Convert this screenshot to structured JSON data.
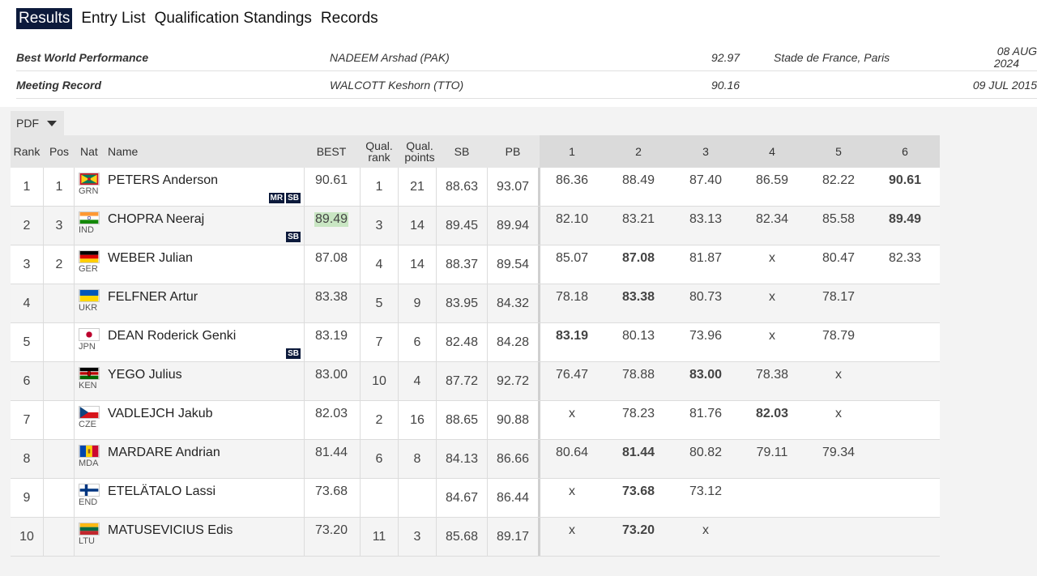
{
  "tabs": [
    "Results",
    "Entry List",
    "Qualification Standings",
    "Records"
  ],
  "records": [
    {
      "label": "Best World Performance",
      "name": "NADEEM Arshad (PAK)",
      "mark": "92.97",
      "venue": "Stade de France, Paris",
      "date_l1": "08 AUG",
      "date_l2": "2024"
    },
    {
      "label": "Meeting Record",
      "name": "WALCOTT Keshorn (TTO)",
      "mark": "90.16",
      "venue": "",
      "date_l1": "09 JUL 2015",
      "date_l2": ""
    }
  ],
  "pdf_label": "PDF",
  "headers": {
    "rank": "Rank",
    "pos": "Pos",
    "nat": "Nat",
    "name": "Name",
    "best": "BEST",
    "qrank_1": "Qual.",
    "qrank_2": "rank",
    "qpts_1": "Qual.",
    "qpts_2": "points",
    "sb": "SB",
    "pb": "PB",
    "a1": "1",
    "a2": "2",
    "a3": "3",
    "a4": "4",
    "a5": "5",
    "a6": "6"
  },
  "colors": {
    "accent": "#0c1a3b",
    "highlight": "#c9e6c3"
  },
  "rows": [
    {
      "rank": "1",
      "pos": "1",
      "nat": "GRN",
      "flag": "grenada-flag",
      "name": "PETERS Anderson",
      "badges": [
        "MR",
        "SB"
      ],
      "best": "90.61",
      "qrank": "1",
      "qpts": "21",
      "sb": "88.63",
      "pb": "93.07",
      "attempts": [
        "86.36",
        "88.49",
        "87.40",
        "86.59",
        "82.22",
        "90.61"
      ],
      "bold": [
        5
      ]
    },
    {
      "rank": "2",
      "pos": "3",
      "nat": "IND",
      "flag": "india-flag",
      "name": "CHOPRA Neeraj",
      "badges": [
        "SB"
      ],
      "best": "89.49",
      "qrank": "3",
      "qpts": "14",
      "sb": "89.45",
      "pb": "89.94",
      "attempts": [
        "82.10",
        "83.21",
        "83.13",
        "82.34",
        "85.58",
        "89.49"
      ],
      "bold": [
        5
      ]
    },
    {
      "rank": "3",
      "pos": "2",
      "nat": "GER",
      "flag": "germany-flag",
      "name": "WEBER Julian",
      "badges": [],
      "best": "87.08",
      "qrank": "4",
      "qpts": "14",
      "sb": "88.37",
      "pb": "89.54",
      "attempts": [
        "85.07",
        "87.08",
        "81.87",
        "x",
        "80.47",
        "82.33"
      ],
      "bold": [
        1
      ]
    },
    {
      "rank": "4",
      "pos": "",
      "nat": "UKR",
      "flag": "ukraine-flag",
      "name": "FELFNER Artur",
      "badges": [],
      "best": "83.38",
      "qrank": "5",
      "qpts": "9",
      "sb": "83.95",
      "pb": "84.32",
      "attempts": [
        "78.18",
        "83.38",
        "80.73",
        "x",
        "78.17",
        ""
      ],
      "bold": [
        1
      ]
    },
    {
      "rank": "5",
      "pos": "",
      "nat": "JPN",
      "flag": "japan-flag",
      "name": "DEAN Roderick Genki",
      "badges": [
        "SB"
      ],
      "best": "83.19",
      "qrank": "7",
      "qpts": "6",
      "sb": "82.48",
      "pb": "84.28",
      "attempts": [
        "83.19",
        "80.13",
        "73.96",
        "x",
        "78.79",
        ""
      ],
      "bold": [
        0
      ]
    },
    {
      "rank": "6",
      "pos": "",
      "nat": "KEN",
      "flag": "kenya-flag",
      "name": "YEGO Julius",
      "badges": [],
      "best": "83.00",
      "qrank": "10",
      "qpts": "4",
      "sb": "87.72",
      "pb": "92.72",
      "attempts": [
        "76.47",
        "78.88",
        "83.00",
        "78.38",
        "x",
        ""
      ],
      "bold": [
        2
      ]
    },
    {
      "rank": "7",
      "pos": "",
      "nat": "CZE",
      "flag": "czechia-flag",
      "name": "VADLEJCH Jakub",
      "badges": [],
      "best": "82.03",
      "qrank": "2",
      "qpts": "16",
      "sb": "88.65",
      "pb": "90.88",
      "attempts": [
        "x",
        "78.23",
        "81.76",
        "82.03",
        "x",
        ""
      ],
      "bold": [
        3
      ]
    },
    {
      "rank": "8",
      "pos": "",
      "nat": "MDA",
      "flag": "moldova-flag",
      "name": "MARDARE Andrian",
      "badges": [],
      "best": "81.44",
      "qrank": "6",
      "qpts": "8",
      "sb": "84.13",
      "pb": "86.66",
      "attempts": [
        "80.64",
        "81.44",
        "80.82",
        "79.11",
        "79.34",
        ""
      ],
      "bold": [
        1
      ]
    },
    {
      "rank": "9",
      "pos": "",
      "nat": "END",
      "flag": "finland-flag",
      "name": "ETELÄTALO Lassi",
      "badges": [],
      "best": "73.68",
      "qrank": "",
      "qpts": "",
      "sb": "84.67",
      "pb": "86.44",
      "attempts": [
        "x",
        "73.68",
        "73.12",
        "",
        "",
        ""
      ],
      "bold": [
        1
      ]
    },
    {
      "rank": "10",
      "pos": "",
      "nat": "LTU",
      "flag": "lithuania-flag",
      "name": "MATUSEVICIUS Edis",
      "badges": [],
      "best": "73.20",
      "qrank": "11",
      "qpts": "3",
      "sb": "85.68",
      "pb": "89.17",
      "attempts": [
        "x",
        "73.20",
        "x",
        "",
        "",
        ""
      ],
      "bold": [
        1
      ]
    }
  ]
}
